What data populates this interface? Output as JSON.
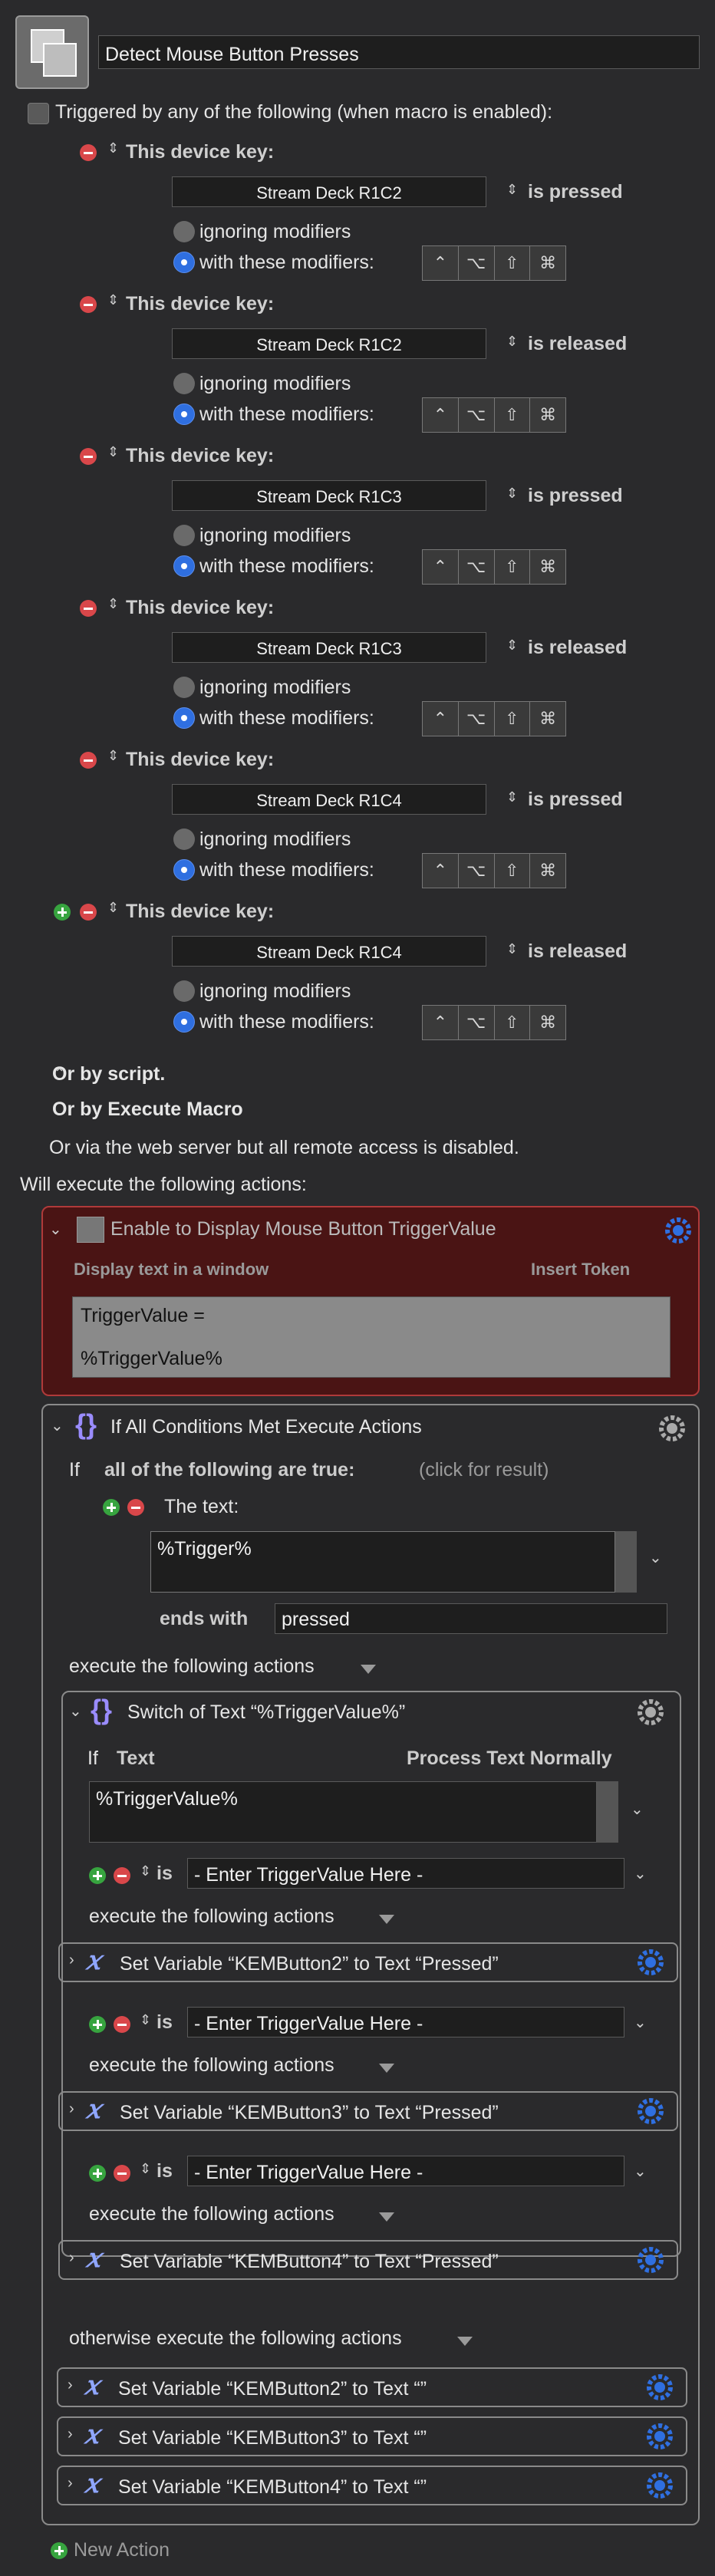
{
  "header": {
    "macro_name": "Detect Mouse Button Presses"
  },
  "triggers": {
    "enable_label": "Triggered by any of the following (when macro is enabled):",
    "device_key_label": "This device key:",
    "ignoring_label": "ignoring modifiers",
    "with_label": "with these modifiers:",
    "modifier_symbols": [
      "⌃",
      "⌥",
      "⇧",
      "⌘"
    ],
    "items": [
      {
        "key": "Stream Deck R1C2",
        "state": "is pressed"
      },
      {
        "key": "Stream Deck R1C2",
        "state": "is released"
      },
      {
        "key": "Stream Deck R1C3",
        "state": "is pressed"
      },
      {
        "key": "Stream Deck R1C3",
        "state": "is released"
      },
      {
        "key": "Stream Deck R1C4",
        "state": "is pressed"
      },
      {
        "key": "Stream Deck R1C4",
        "state": "is released"
      }
    ],
    "or_script": "Or by script.",
    "or_execute": "Or by Execute Macro",
    "web_server": "Or via the web server but all remote access is disabled."
  },
  "actions_heading": "Will execute the following actions:",
  "action1": {
    "title": "Enable to Display Mouse Button TriggerValue",
    "display_mode": "Display text in a window",
    "insert_token": "Insert Token",
    "text_line1": "TriggerValue =",
    "text_line2": "%TriggerValue%"
  },
  "action2": {
    "title": "If All Conditions Met Execute Actions",
    "if_label": "If",
    "all_label": "all of the following are true:",
    "click_result": "(click for result)",
    "the_text_label": "The text:",
    "text_value": "%Trigger%",
    "ends_with_label": "ends with",
    "ends_with_value": "pressed",
    "execute_label": "execute the following actions",
    "otherwise_label": "otherwise execute the following actions"
  },
  "switch": {
    "title": "Switch of Text “%TriggerValue%”",
    "if_label": "If",
    "text_label": "Text",
    "process_label": "Process Text Normally",
    "text_value": "%TriggerValue%",
    "is_label": "is",
    "case_placeholder": "- Enter TriggerValue Here -",
    "execute_label": "execute the following actions",
    "cases": [
      {
        "action": "Set Variable “KEMButton2” to Text “Pressed”"
      },
      {
        "action": "Set Variable “KEMButton3” to Text “Pressed”"
      },
      {
        "action": "Set Variable “KEMButton4” to Text “Pressed”"
      }
    ]
  },
  "otherwise_actions": [
    "Set Variable “KEMButton2” to Text “”",
    "Set Variable “KEMButton3” to Text “”",
    "Set Variable “KEMButton4” to Text “”"
  ],
  "new_action": "New Action",
  "colors": {
    "accent_blue": "#2f6fe0",
    "disabled_red": "#4a1414",
    "remove_red": "#d9474a",
    "add_green": "#37a43f"
  }
}
